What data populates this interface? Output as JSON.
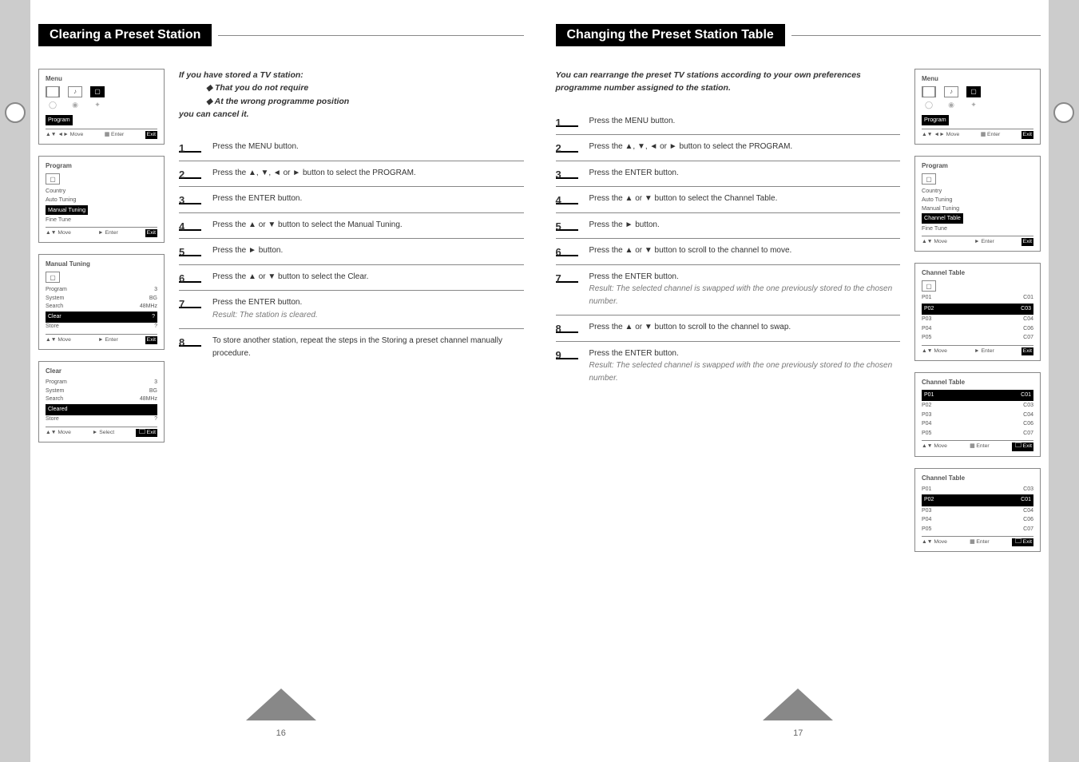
{
  "left": {
    "title": "Clearing a Preset Station",
    "intro": {
      "lead": "If you have stored a TV station:",
      "b1": "That you do not require",
      "b2": "At the wrong programme position",
      "tail": "you can cancel it."
    },
    "steps": [
      {
        "n": "1",
        "t": "Press the MENU button."
      },
      {
        "n": "2",
        "t": "Press the ▲, ▼, ◄ or ► button to select the PROGRAM."
      },
      {
        "n": "3",
        "t": "Press the ENTER button."
      },
      {
        "n": "4",
        "t": "Press the ▲ or ▼ button to select the Manual Tuning."
      },
      {
        "n": "5",
        "t": "Press the ► button."
      },
      {
        "n": "6",
        "t": "Press the ▲ or ▼ button to select the Clear."
      },
      {
        "n": "7",
        "t": "Press the ENTER button.",
        "r": "Result: The station is cleared."
      },
      {
        "n": "8",
        "t": "To store another station, repeat the steps in the Storing a preset channel manually procedure."
      }
    ],
    "screens": {
      "menu": {
        "subtitle": "Menu",
        "footMove": "▲▼ ◄► Move",
        "footEnter": "Enter",
        "footExit": "Exit"
      },
      "program": {
        "subtitle": "Program",
        "icon": "▢",
        "items": [
          "Country",
          "Auto Tuning",
          "Manual Tuning",
          "Fine Tune"
        ],
        "sel": "Manual Tuning",
        "footMove": "▲▼ Move",
        "footEnter": "► Enter",
        "footExit": "Exit"
      },
      "manual": {
        "subtitle": "Manual Tuning",
        "rows": [
          [
            "Program",
            "3"
          ],
          [
            "System",
            "BG"
          ],
          [
            "Search",
            "48MHz"
          ],
          [
            "Clear",
            "?"
          ],
          [
            "Store",
            "?"
          ]
        ],
        "sel": "Clear",
        "footMove": "▲▼ Move",
        "footEnter": "► Enter",
        "footExit": "Exit"
      },
      "clear": {
        "subtitle": "Clear",
        "rows": [
          [
            "Program",
            "3"
          ],
          [
            "System",
            "BG"
          ],
          [
            "Search",
            "48MHz"
          ],
          [
            "Cleared",
            ""
          ],
          [
            "Store",
            "?"
          ]
        ],
        "sel": "Cleared",
        "footMove": "▲▼ Move",
        "footSel": "► Select",
        "footExit": "Exit"
      }
    },
    "pageNum": "16"
  },
  "right": {
    "title": "Changing the Preset Station Table",
    "intro": "You can rearrange the preset TV stations according to your own preferences programme number assigned to the station.",
    "steps": [
      {
        "n": "1",
        "t": "Press the MENU button."
      },
      {
        "n": "2",
        "t": "Press the ▲, ▼, ◄ or ► button to select the PROGRAM."
      },
      {
        "n": "3",
        "t": "Press the ENTER button."
      },
      {
        "n": "4",
        "t": "Press the ▲ or ▼ button to select the Channel Table."
      },
      {
        "n": "5",
        "t": "Press the ► button."
      },
      {
        "n": "6",
        "t": "Press the ▲ or ▼ button to scroll to the channel to move."
      },
      {
        "n": "7",
        "t": "Press the ENTER button.",
        "r": "Result: The selected channel is swapped with the one previously stored to the chosen number."
      },
      {
        "n": "8",
        "t": "Press the ▲ or ▼ button to scroll to the channel to swap."
      },
      {
        "n": "9",
        "t": "Press the ENTER button.",
        "r": "Result: The selected channel is swapped with the one previously stored to the chosen number."
      }
    ],
    "screens": {
      "menu": {
        "subtitle": "Menu",
        "footMove": "▲▼ ◄► Move",
        "footEnter": "Enter",
        "footExit": "Exit"
      },
      "program": {
        "subtitle": "Program",
        "items": [
          "Country",
          "Auto Tuning",
          "Manual Tuning",
          "Channel Table",
          "Fine Tune"
        ],
        "sel": "Channel Table",
        "footMove": "▲▼ Move",
        "footEnter": "► Enter",
        "footExit": "Exit"
      },
      "table": {
        "subtitle": "Channel Table",
        "rows": [
          [
            "P01",
            "C01"
          ],
          [
            "P02",
            "C03"
          ],
          [
            "P03",
            "C04"
          ],
          [
            "P04",
            "C06"
          ],
          [
            "P05",
            "C07"
          ]
        ],
        "sel": "P02",
        "footMove": "▲▼ Move",
        "footEnter": "► Enter",
        "footExit": "Exit"
      },
      "swap1": {
        "subtitle": "Channel Table",
        "rows": [
          [
            "P01",
            "C01"
          ],
          [
            "P02",
            "C03"
          ],
          [
            "P03",
            "C04"
          ],
          [
            "P04",
            "C06"
          ],
          [
            "P05",
            "C07"
          ]
        ],
        "sel": "P01",
        "footMove": "▲▼ Move",
        "footEnter": "Enter",
        "footExit": "Exit"
      },
      "swap2": {
        "subtitle": "Channel Table",
        "rows": [
          [
            "P01",
            "C03"
          ],
          [
            "P02",
            "C01"
          ],
          [
            "P03",
            "C04"
          ],
          [
            "P04",
            "C06"
          ],
          [
            "P05",
            "C07"
          ]
        ],
        "sel": "P02",
        "footMove": "▲▼ Move",
        "footEnter": "Enter",
        "footExit": "Exit"
      }
    },
    "pageNum": "17"
  }
}
